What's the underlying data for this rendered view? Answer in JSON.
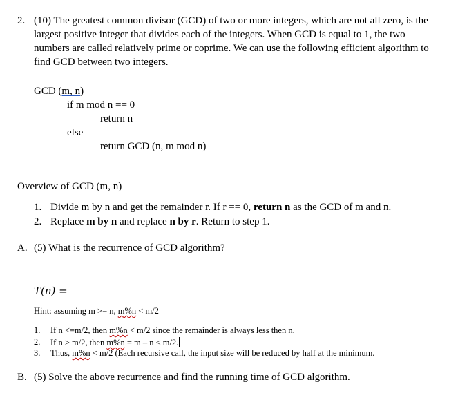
{
  "question": {
    "number": "2.",
    "intro": "(10) The greatest common divisor (GCD) of two or more integers, which are not all zero, is the largest positive integer that divides each of the integers. When GCD is equal to 1, the two numbers are called relatively prime or coprime. We can use the following efficient algorithm to find GCD between two integers."
  },
  "pseudocode": {
    "signature_name": "GCD (",
    "signature_params": "m,  n",
    "signature_close": ")",
    "line_if": "if m mod n == 0",
    "line_return_n": "return n",
    "line_else": "else",
    "line_return_gcd": "return GCD (n, m mod n)"
  },
  "overview": {
    "title": "Overview of GCD (m, n)",
    "steps": [
      {
        "num": "1.",
        "pre": "Divide m by n and get the remainder r. If r == 0, ",
        "bold": "return n",
        "post": " as the GCD of m and n."
      },
      {
        "num": "2.",
        "pre": "Replace ",
        "bold1": "m by n",
        "mid": " and replace ",
        "bold2": "n by r",
        "post": ". Return to step 1."
      }
    ]
  },
  "part_a": {
    "label": "A.",
    "text": "(5) What is the recurrence of GCD algorithm?",
    "formula": "T(n) =",
    "hint_pre": "Hint: assuming m >= n, ",
    "hint_squig": "m%n",
    "hint_post": " < m/2",
    "steps": [
      {
        "num": "1.",
        "pre": "If n <=m/2, then ",
        "squig": "m%n",
        "post": " < m/2 since the remainder is always less then n."
      },
      {
        "num": "2.",
        "pre": "If n > m/2, then ",
        "squig": "m%n",
        "post": " = m – n < m/2."
      },
      {
        "num": "3.",
        "pre": "Thus, ",
        "squig": "m%n",
        "post": " < m/2 (Each recursive call, the input size will be reduced by half at the minimum."
      }
    ]
  },
  "part_b": {
    "label": "B.",
    "text": "(5) Solve the above recurrence and find the running time of GCD algorithm."
  }
}
